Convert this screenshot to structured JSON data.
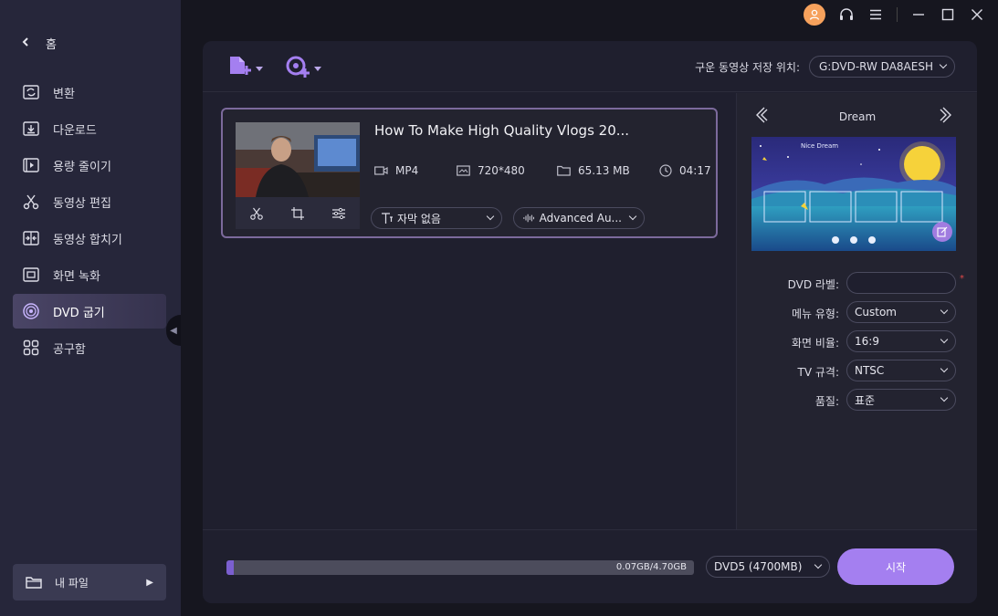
{
  "sidebar": {
    "home_label": "홈",
    "items": [
      {
        "label": "변환",
        "icon": "convert-icon"
      },
      {
        "label": "다운로드",
        "icon": "download-icon"
      },
      {
        "label": "용량 줄이기",
        "icon": "compress-icon"
      },
      {
        "label": "동영상 편집",
        "icon": "scissors-icon"
      },
      {
        "label": "동영상 합치기",
        "icon": "merge-icon"
      },
      {
        "label": "화면 녹화",
        "icon": "screen-record-icon"
      },
      {
        "label": "DVD 굽기",
        "icon": "disc-icon",
        "active": true
      },
      {
        "label": "공구함",
        "icon": "toolbox-icon"
      }
    ],
    "my_files_label": "내 파일"
  },
  "toolbar": {
    "save_location_label": "구운 동영상 저장 위치:",
    "save_location_value": "G:DVD-RW DA8AESH"
  },
  "video": {
    "title": "How To Make High Quality Vlogs 20...",
    "format": "MP4",
    "resolution": "720*480",
    "size": "65.13 MB",
    "duration": "04:17",
    "subtitle_option": "자막 없음",
    "audio_option": "Advanced Au..."
  },
  "template": {
    "name": "Dream",
    "preview_title": "Nice Dream"
  },
  "settings": {
    "dvd_label_label": "DVD 라벨:",
    "dvd_label_value": "",
    "menu_type_label": "메뉴 유형:",
    "menu_type_value": "Custom",
    "aspect_label": "화면 비율:",
    "aspect_value": "16:9",
    "tv_standard_label": "TV 규격:",
    "tv_standard_value": "NTSC",
    "quality_label": "품질:",
    "quality_value": "표준",
    "required_mark": "*"
  },
  "bottom": {
    "progress_fraction": 0.015,
    "progress_text": "0.07GB/4.70GB",
    "disc_value": "DVD5 (4700MB)",
    "start_label": "시작"
  },
  "colors": {
    "accent": "#a47ff0",
    "progress_fill": "#7b5fd0",
    "avatar": "#f6a15c",
    "required": "#e04848"
  }
}
